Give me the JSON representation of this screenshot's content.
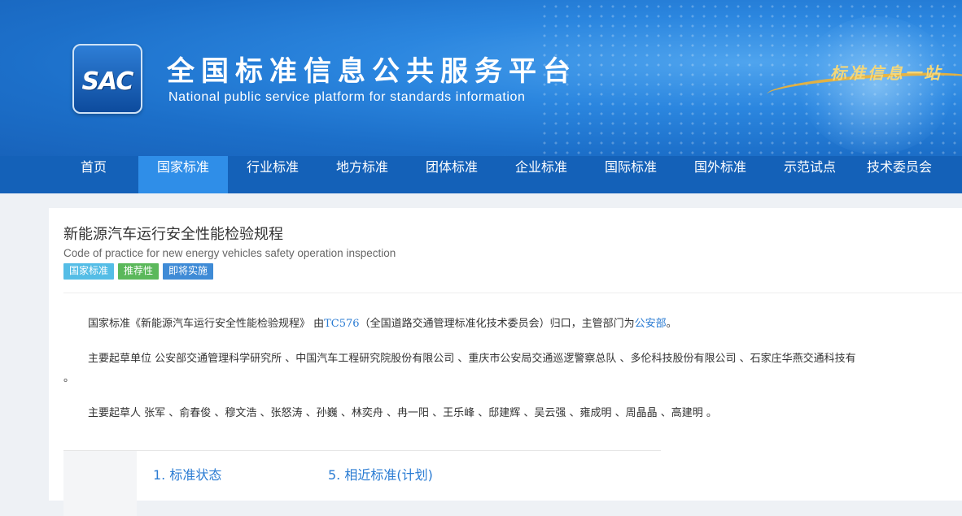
{
  "header": {
    "logo_text": "SAC",
    "title": "全国标准信息公共服务平台",
    "subtitle": "National public service platform  for standards information",
    "slogan": "标准信息一站",
    "accent_color": "#1461b8"
  },
  "nav": {
    "items": [
      {
        "label": "首页"
      },
      {
        "label": "国家标准",
        "active": true
      },
      {
        "label": "行业标准"
      },
      {
        "label": "地方标准"
      },
      {
        "label": "团体标准"
      },
      {
        "label": "企业标准"
      },
      {
        "label": "国际标准"
      },
      {
        "label": "国外标准"
      },
      {
        "label": "示范试点"
      },
      {
        "label": "技术委员会"
      }
    ]
  },
  "standard": {
    "title": "新能源汽车运行安全性能检验规程",
    "title_en": "Code of practice for new energy vehicles safety operation inspection",
    "tags": [
      "国家标准",
      "推荐性",
      "即将实施"
    ],
    "desc": {
      "prefix": "国家标准《新能源汽车运行安全性能检验规程》 由",
      "tc_code": "TC576",
      "middle": "（全国道路交通管理标准化技术委员会）归口，主管部门为",
      "dept": "公安部",
      "suffix": "。"
    },
    "drafting_units_label": "主要起草单位",
    "drafting_units": "公安部交通管理科学研究所 、中国汽车工程研究院股份有限公司 、重庆市公安局交通巡逻警察总队 、多伦科技股份有限公司 、石家庄华燕交通科技有",
    "drafting_units_tail": "。",
    "drafters_label": "主要起草人",
    "drafters": "张军 、俞春俊 、穆文浩 、张怒涛 、孙巍 、林奕舟 、冉一阳 、王乐峰 、邸建辉 、吴云强 、雍成明 、周晶晶 、高建明 。"
  },
  "sections": [
    "1. 标准状态",
    "5. 相近标准(计划)"
  ]
}
